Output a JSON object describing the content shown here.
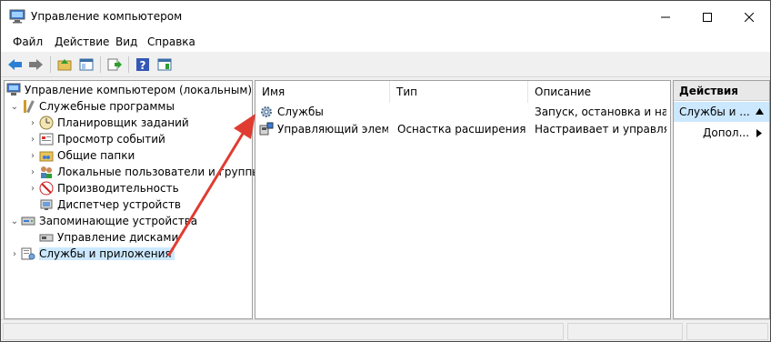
{
  "window": {
    "title": "Управление компьютером"
  },
  "menu": [
    "Файл",
    "Действие",
    "Вид",
    "Справка"
  ],
  "tree": {
    "root": "Управление компьютером (локальным)",
    "system_tools": "Служебные программы",
    "task_scheduler": "Планировщик заданий",
    "event_viewer": "Просмотр событий",
    "shared_folders": "Общие папки",
    "local_users": "Локальные пользователи и группы",
    "performance": "Производительность",
    "device_manager": "Диспетчер устройств",
    "storage": "Запоминающие устройства",
    "disk_management": "Управление дисками",
    "services_apps": "Службы и приложения"
  },
  "list": {
    "columns": [
      "Имя",
      "Тип",
      "Описание"
    ],
    "rows": [
      {
        "name": "Службы",
        "type": "",
        "desc": "Запуск, остановка и на..."
      },
      {
        "name": "Управляющий элем...",
        "type": "Оснастка расширения",
        "desc": "Настраивает и управля..."
      }
    ]
  },
  "actions": {
    "header": "Действия",
    "selected": "Службы и ...",
    "more": "Допол..."
  },
  "colors": {
    "arrow": "#e03c31",
    "selection": "#cce8ff"
  }
}
